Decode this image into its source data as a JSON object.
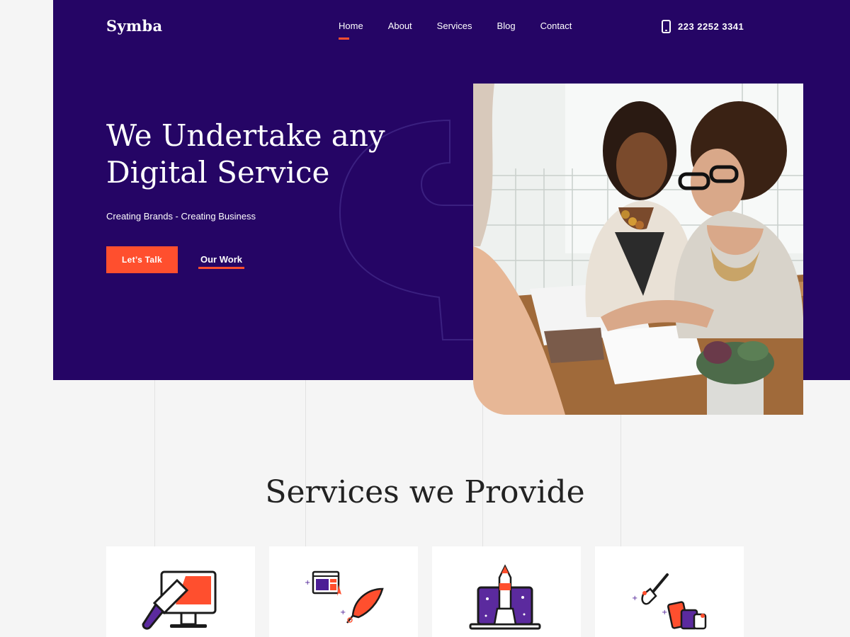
{
  "brand": {
    "name": "Symba"
  },
  "nav": {
    "items": [
      {
        "label": "Home",
        "active": true
      },
      {
        "label": "About",
        "active": false
      },
      {
        "label": "Services",
        "active": false
      },
      {
        "label": "Blog",
        "active": false
      },
      {
        "label": "Contact",
        "active": false
      }
    ],
    "phone": "223 2252 3341"
  },
  "hero": {
    "headline_line1": "We Undertake any",
    "headline_line2": "Digital Service",
    "tagline": "Creating Brands - Creating Business",
    "primary_button": "Let’s Talk",
    "secondary_link": "Our Work"
  },
  "services": {
    "title": "Services we Provide",
    "cards": [
      {
        "icon": "monitor-paint-brush-icon"
      },
      {
        "icon": "web-design-quill-icon"
      },
      {
        "icon": "rocket-laptop-icon"
      },
      {
        "icon": "brush-color-palette-icon"
      }
    ]
  },
  "colors": {
    "primary": "#250565",
    "accent": "#ff4f2e",
    "background": "#f5f5f5"
  }
}
